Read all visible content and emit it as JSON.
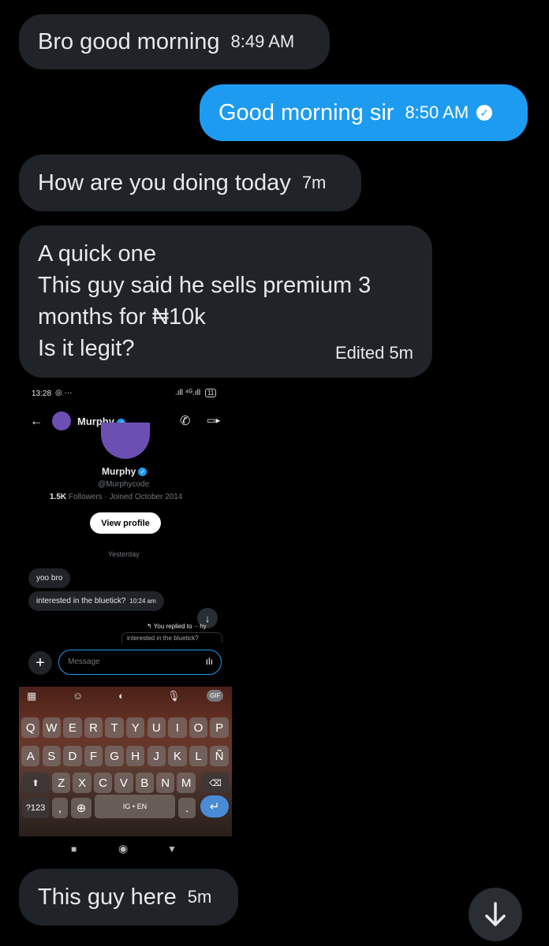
{
  "messages": [
    {
      "text": "Bro good morning",
      "time": "8:49 AM"
    },
    {
      "text": "Good morning sir",
      "time": "8:50 AM"
    },
    {
      "text": "How are you doing today",
      "time": "7m"
    },
    {
      "text": "A quick one\nThis guy said he sells premium 3\nmonths for ₦10k\nIs it legit?",
      "time": "Edited 5m"
    },
    {
      "text": "This guy here",
      "time": "5m"
    }
  ],
  "screenshot": {
    "status_time": "13:28",
    "status_battery": "11",
    "header_name": "Murphy",
    "profile_name": "Murphy",
    "handle": "@Murphycode",
    "followers_count": "1.5K",
    "followers_label": "Followers",
    "joined": "· Joined October 2014",
    "view_profile": "View profile",
    "day_label": "Yesterday",
    "msg1": "yoo bro",
    "msg2": "interested in the bluetick?",
    "msg2_time": "10:24 am",
    "reply_note": "You replied to",
    "reply_note_end": "hy",
    "reply_preview": "interested in the bluetick?",
    "message_placeholder": "Message",
    "keyboard": {
      "row1": [
        "Q",
        "W",
        "E",
        "R",
        "T",
        "Y",
        "U",
        "I",
        "O",
        "P"
      ],
      "row2": [
        "A",
        "S",
        "D",
        "F",
        "G",
        "H",
        "J",
        "K",
        "L",
        "Ñ"
      ],
      "row3": [
        "Z",
        "X",
        "C",
        "V",
        "B",
        "N",
        "M"
      ],
      "sym": "?123",
      "space": "IG • EN",
      "gif": "GIF"
    }
  },
  "colors": {
    "accent": "#1d9bf0",
    "bubble": "#202327",
    "background": "#000000"
  }
}
